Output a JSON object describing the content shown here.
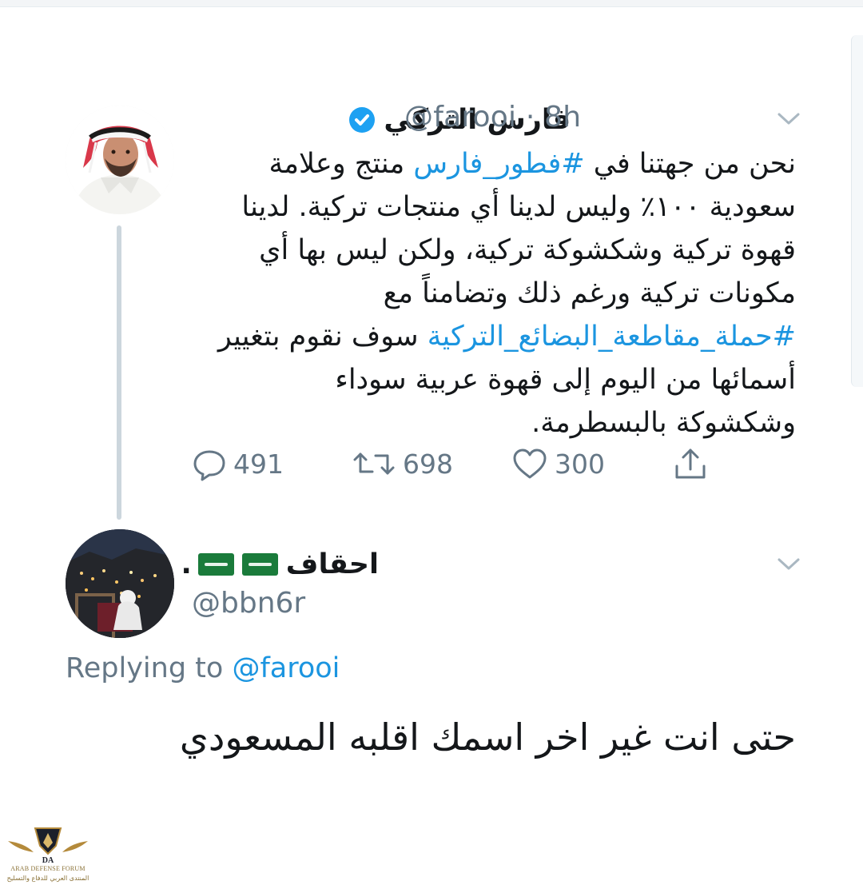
{
  "tweet": {
    "author_name": "فارس التركي",
    "handle": "@farooi",
    "time": "8h",
    "separator": "·",
    "verified": true,
    "body_parts": [
      {
        "type": "text",
        "text": "نحن من جهتنا في "
      },
      {
        "type": "hashtag",
        "text": "#فطور_فارس"
      },
      {
        "type": "text",
        "text": " منتج وعلامة سعودية ١٠٠٪ وليس لدينا أي منتجات تركية. لدينا قهوة تركية وشكشوكة تركية، ولكن ليس بها أي مكونات تركية ورغم ذلك وتضامناً مع "
      },
      {
        "type": "hashtag",
        "text": "#حملة_مقاطعة_البضائع_التركية"
      },
      {
        "type": "text",
        "text": " سوف نقوم بتغيير أسمائها من اليوم إلى قهوة عربية سوداء وشكشوكة بالبسطرمة."
      }
    ],
    "actions": {
      "replies": "491",
      "retweets": "698",
      "likes": "300"
    }
  },
  "reply": {
    "author_name": "احقاف",
    "name_suffix": ".",
    "handle": "@bbn6r",
    "replying_to_label": "Replying to",
    "replying_to_handle": "@farooi",
    "body": "حتى انت غير اخر اسمك اقلبه المسعودي"
  },
  "watermark": {
    "title": "ARAB DEFENSE FORUM",
    "subtitle": "المنتدى العربي للدفاع والتسليح",
    "monogram": "DA"
  },
  "icons": {
    "verified": "verified-badge-icon",
    "caret": "chevron-down-icon",
    "reply": "reply-icon",
    "retweet": "retweet-icon",
    "like": "heart-icon",
    "share": "share-icon",
    "flag": "saudi-flag-icon"
  },
  "colors": {
    "link": "#1b95e0",
    "muted": "#657786",
    "text": "#14171a",
    "thread_line": "#ccd6dd"
  }
}
